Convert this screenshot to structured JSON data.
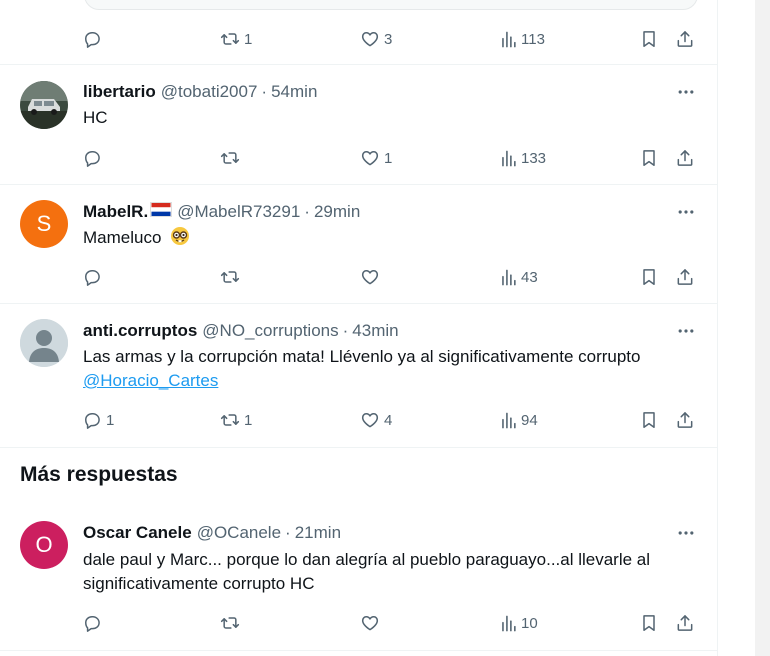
{
  "colors": {
    "accent": "#1d9bf0",
    "muted": "#536471",
    "text": "#0f1419",
    "avatar_s": "#f4700f",
    "avatar_o": "#cc1f5f"
  },
  "top_actions": {
    "reply": "",
    "retweet": "1",
    "like": "3",
    "views": "113"
  },
  "tweets": [
    {
      "name": "libertario",
      "handle": "@tobati2007",
      "separator": "·",
      "time": "54min",
      "text": "HC",
      "actions": {
        "reply": "",
        "retweet": "",
        "like": "1",
        "views": "133"
      },
      "avatar": "photo-car"
    },
    {
      "name": "MabelR.",
      "flag": "paraguay-flag",
      "handle": "@MabelR73291",
      "separator": "·",
      "time": "29min",
      "text": "Mameluco",
      "emoji": "nerd-face-emoji",
      "actions": {
        "reply": "",
        "retweet": "",
        "like": "",
        "views": "43"
      },
      "avatar_letter": "S"
    },
    {
      "name": "anti.corruptos",
      "handle": "@NO_corruptions",
      "separator": "·",
      "time": "43min",
      "text": "Las armas y la corrupción mata! Llévenlo ya al significativamente corrupto",
      "mention": "@Horacio_Cartes",
      "actions": {
        "reply": "1",
        "retweet": "1",
        "like": "4",
        "views": "94"
      },
      "avatar": "default-user"
    }
  ],
  "section_title": "Más respuestas",
  "more_replies": [
    {
      "name": "Oscar Canele",
      "handle": "@OCanele",
      "separator": "·",
      "time": "21min",
      "text_line1": "dale paul y Marc... porque lo dan alegría al pueblo paraguayo...al llevarle al",
      "text_line2": "significativamente corrupto HC",
      "actions": {
        "reply": "",
        "retweet": "",
        "like": "",
        "views": "10"
      },
      "avatar_letter": "O"
    }
  ]
}
